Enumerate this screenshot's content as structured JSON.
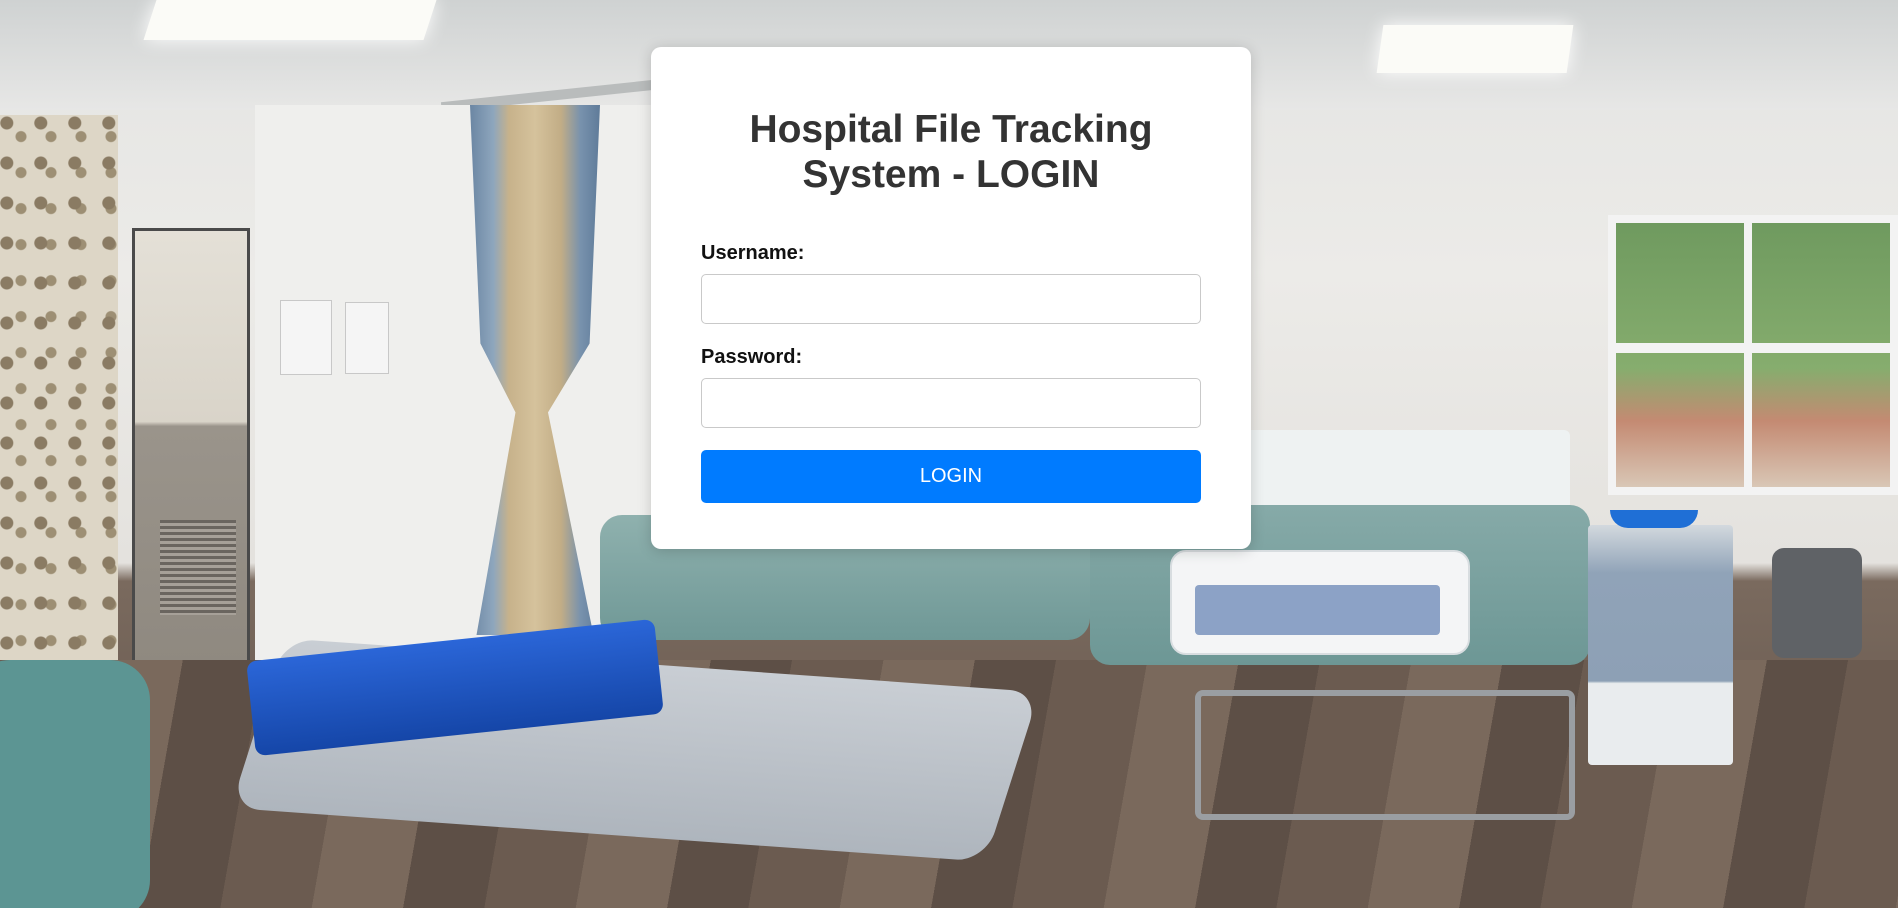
{
  "login": {
    "title": "Hospital File Tracking System - LOGIN",
    "username_label": "Username:",
    "username_value": "",
    "password_label": "Password:",
    "password_value": "",
    "submit_label": "LOGIN"
  },
  "colors": {
    "button": "#007bff",
    "card": "#ffffff",
    "title_text": "#333333"
  }
}
